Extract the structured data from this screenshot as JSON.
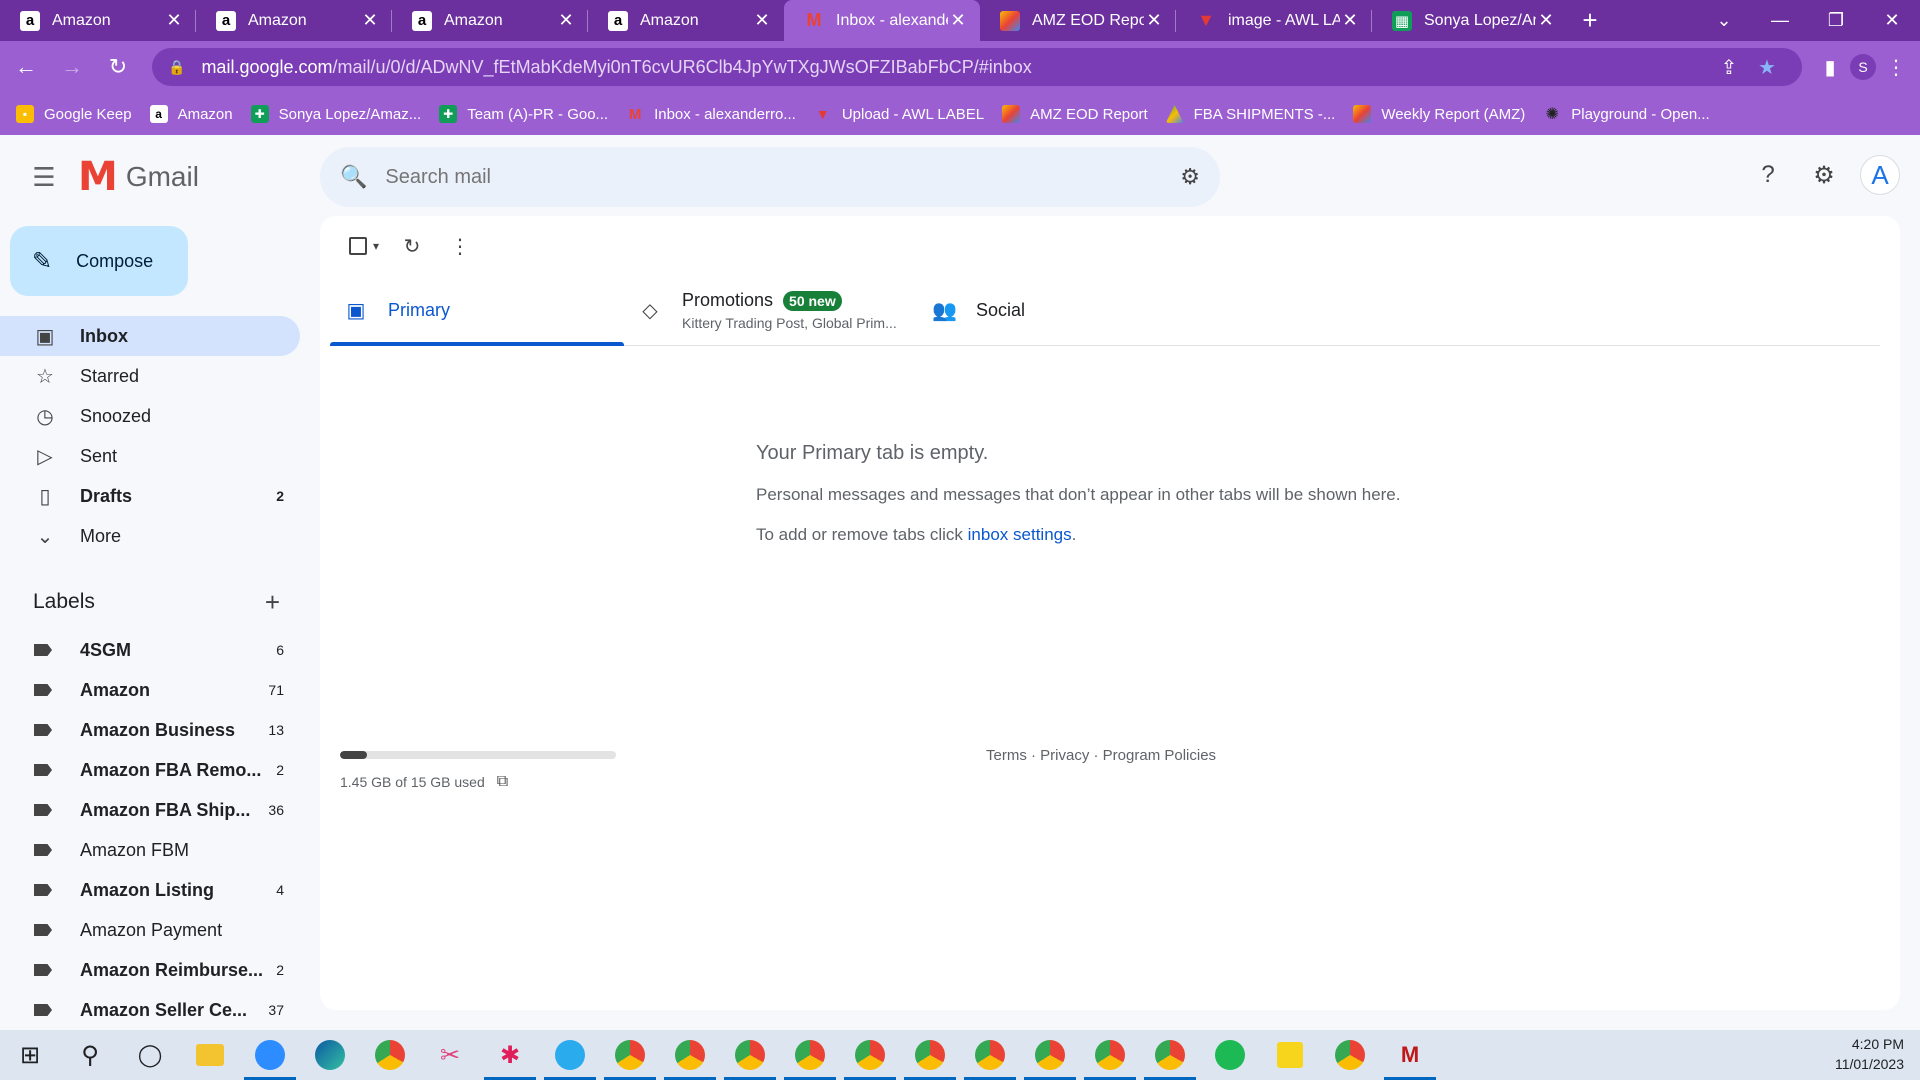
{
  "browser": {
    "tabs": [
      {
        "title": "Amazon",
        "favicon": "amazon-icon",
        "active": false
      },
      {
        "title": "Amazon",
        "favicon": "amazon-icon",
        "active": false
      },
      {
        "title": "Amazon",
        "favicon": "amazon-icon",
        "active": false
      },
      {
        "title": "Amazon",
        "favicon": "amazon-icon",
        "active": false
      },
      {
        "title": "Inbox - alexande",
        "favicon": "gmail-icon",
        "active": true
      },
      {
        "title": "AMZ EOD Repor",
        "favicon": "amz-eod-icon",
        "active": false
      },
      {
        "title": "image - AWL LAI",
        "favicon": "awl-icon",
        "active": false
      },
      {
        "title": "Sonya Lopez/Am",
        "favicon": "sheets-icon",
        "active": false
      }
    ],
    "url_host": "mail.google.com",
    "url_path": "/mail/u/0/d/ADwNV_fEtMabKdeMyi0nT6cvUR6Clb4JpYwTXgJWsOFZIBabFbCP/#inbox",
    "profile_initial": "S",
    "bookmarks": [
      {
        "label": "Google Keep",
        "icon": "keep-icon"
      },
      {
        "label": "Amazon",
        "icon": "amazon-icon"
      },
      {
        "label": "Sonya Lopez/Amaz...",
        "icon": "sheets-icon"
      },
      {
        "label": "Team (A)-PR - Goo...",
        "icon": "sheets-icon"
      },
      {
        "label": "Inbox - alexanderro...",
        "icon": "gmail-icon"
      },
      {
        "label": "Upload - AWL LABEL",
        "icon": "awl-icon"
      },
      {
        "label": "AMZ EOD Report",
        "icon": "amz-eod-icon"
      },
      {
        "label": "FBA SHIPMENTS -...",
        "icon": "drive-icon"
      },
      {
        "label": "Weekly Report (AMZ)",
        "icon": "amz-eod-icon"
      },
      {
        "label": "Playground - Open...",
        "icon": "openai-icon"
      }
    ]
  },
  "gmail": {
    "logo_text": "Gmail",
    "search_placeholder": "Search mail",
    "avatar_initial": "A",
    "compose_label": "Compose",
    "nav": [
      {
        "label": "Inbox",
        "icon": "inbox-icon",
        "count": "",
        "active": true,
        "bold": true
      },
      {
        "label": "Starred",
        "icon": "star-icon",
        "count": "",
        "active": false,
        "bold": false
      },
      {
        "label": "Snoozed",
        "icon": "clock-icon",
        "count": "",
        "active": false,
        "bold": false
      },
      {
        "label": "Sent",
        "icon": "send-icon",
        "count": "",
        "active": false,
        "bold": false
      },
      {
        "label": "Drafts",
        "icon": "draft-icon",
        "count": "2",
        "active": false,
        "bold": true
      },
      {
        "label": "More",
        "icon": "chevron-down-icon",
        "count": "",
        "active": false,
        "bold": false
      }
    ],
    "labels_title": "Labels",
    "labels": [
      {
        "label": "4SGM",
        "count": "6",
        "bold": true
      },
      {
        "label": "Amazon",
        "count": "71",
        "bold": true
      },
      {
        "label": "Amazon Business",
        "count": "13",
        "bold": true
      },
      {
        "label": "Amazon FBA Remo...",
        "count": "2",
        "bold": true
      },
      {
        "label": "Amazon FBA Ship...",
        "count": "36",
        "bold": true
      },
      {
        "label": "Amazon FBM",
        "count": "",
        "bold": false
      },
      {
        "label": "Amazon Listing",
        "count": "4",
        "bold": true
      },
      {
        "label": "Amazon Payment",
        "count": "",
        "bold": false
      },
      {
        "label": "Amazon Reimburse...",
        "count": "2",
        "bold": true
      },
      {
        "label": "Amazon Seller Ce...",
        "count": "37",
        "bold": true
      }
    ],
    "tabs": {
      "primary": "Primary",
      "promotions": "Promotions",
      "promotions_badge": "50 new",
      "promotions_sub": "Kittery Trading Post, Global Prim...",
      "social": "Social"
    },
    "empty": {
      "title": "Your Primary tab is empty.",
      "line1": "Personal messages and messages that don’t appear in other tabs will be shown here.",
      "line2_prefix": "To add or remove tabs click ",
      "line2_link": "inbox settings",
      "line2_suffix": "."
    },
    "storage_text": "1.45 GB of 15 GB used",
    "storage_fraction": 0.097,
    "footer": "Terms · Privacy · Program Policies"
  },
  "taskbar": {
    "time": "4:20 PM",
    "date": "11/01/2023"
  }
}
